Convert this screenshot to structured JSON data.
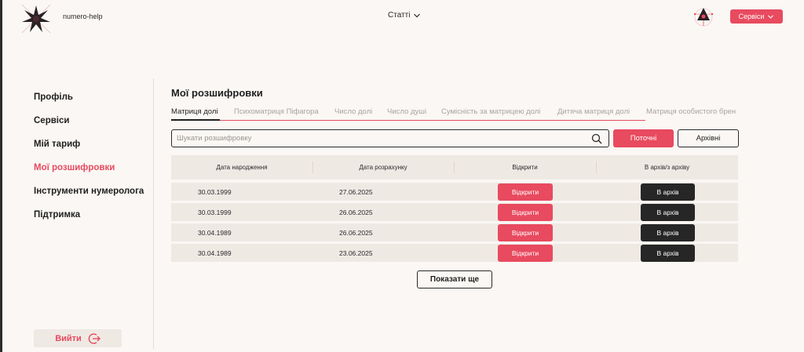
{
  "header": {
    "logo_text": "numero-help",
    "articles_label": "Статті",
    "services_label": "Сервіси"
  },
  "sidebar": {
    "items": [
      {
        "label": "Профіль"
      },
      {
        "label": "Сервіси"
      },
      {
        "label": "Мій тариф"
      },
      {
        "label": "Мої розшифровки"
      },
      {
        "label": "Інструменти нумеролога"
      },
      {
        "label": "Підтримка"
      }
    ],
    "active_index": 3,
    "logout_label": "Вийти"
  },
  "main": {
    "title": "Мої розшифровки",
    "tabs": [
      {
        "label": "Матриця долі"
      },
      {
        "label": "Психоматриця Піфагора"
      },
      {
        "label": "Число долі"
      },
      {
        "label": "Число душі"
      },
      {
        "label": "Сумісність за матрицею долі"
      },
      {
        "label": "Дитяча матриця долі"
      },
      {
        "label": "Матриця особистого брен"
      }
    ],
    "search": {
      "placeholder": "Шукати розшифровку",
      "value": ""
    },
    "filter_current": "Поточні",
    "filter_archive": "Архівні",
    "table": {
      "headers": [
        "Дата народження",
        "Дата розрахунку",
        "Відкрити",
        "В архів/з архіву"
      ],
      "rows": [
        {
          "birth": "30.03.1999",
          "calc": "27.06.2025",
          "open": "Відкрити",
          "archive": "В архів"
        },
        {
          "birth": "30.03.1999",
          "calc": "26.06.2025",
          "open": "Відкрити",
          "archive": "В архів"
        },
        {
          "birth": "30.04.1989",
          "calc": "26.06.2025",
          "open": "Відкрити",
          "archive": "В архів"
        },
        {
          "birth": "30.04.1989",
          "calc": "23.06.2025",
          "open": "Відкрити",
          "archive": "В архів"
        }
      ]
    },
    "show_more": "Показати ще"
  },
  "colors": {
    "accent": "#e84a5f",
    "dark": "#262626",
    "background": "#faf7f4",
    "panel": "#efe9e4"
  }
}
